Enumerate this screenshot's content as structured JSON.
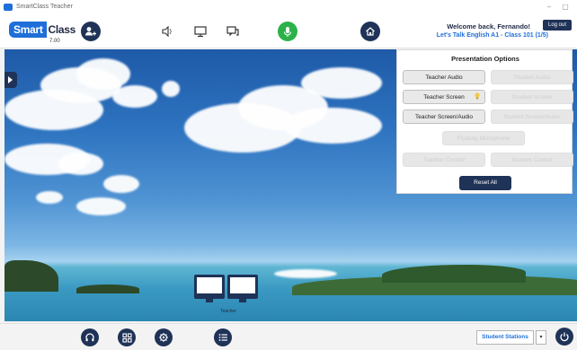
{
  "window": {
    "title": "SmartClass Teacher",
    "minimize": "–",
    "maximize": "▢"
  },
  "brand": {
    "smart": "Smart",
    "class": "Class",
    "version": "7.00"
  },
  "header": {
    "welcome": "Welcome back, Fernando!",
    "class_name": "Let's Talk English A1 - Class 101 (1/5)",
    "logout_label": "Log out",
    "icons": [
      "group-icon",
      "speaker-icon",
      "monitor-icon",
      "chat-icon",
      "microphone-icon",
      "home-icon"
    ]
  },
  "panel": {
    "title": "Presentation Options",
    "options": [
      {
        "label": "Teacher Audio",
        "enabled": true
      },
      {
        "label": "Student Audio",
        "enabled": false
      },
      {
        "label": "Teacher Screen",
        "enabled": true
      },
      {
        "label": "Student Screen",
        "enabled": false
      },
      {
        "label": "Teacher Screen/Audio",
        "enabled": true
      },
      {
        "label": "Student Screen/Audio",
        "enabled": false
      },
      {
        "label": "Floating Microphone",
        "enabled": false
      },
      {
        "label": "Teacher Control",
        "enabled": false
      },
      {
        "label": "Student Control",
        "enabled": false
      }
    ],
    "reset_label": "Reset All"
  },
  "stations": {
    "teacher_label": "Teacher"
  },
  "footer": {
    "icons": [
      "headset-icon",
      "grid-icon",
      "settings-icon",
      "list-icon",
      "power-icon"
    ],
    "station_select": "Student Stations",
    "caret": "▾"
  },
  "colors": {
    "navy": "#1f3257",
    "brand_blue": "#1e6fd9",
    "mic_green": "#2db14a"
  }
}
